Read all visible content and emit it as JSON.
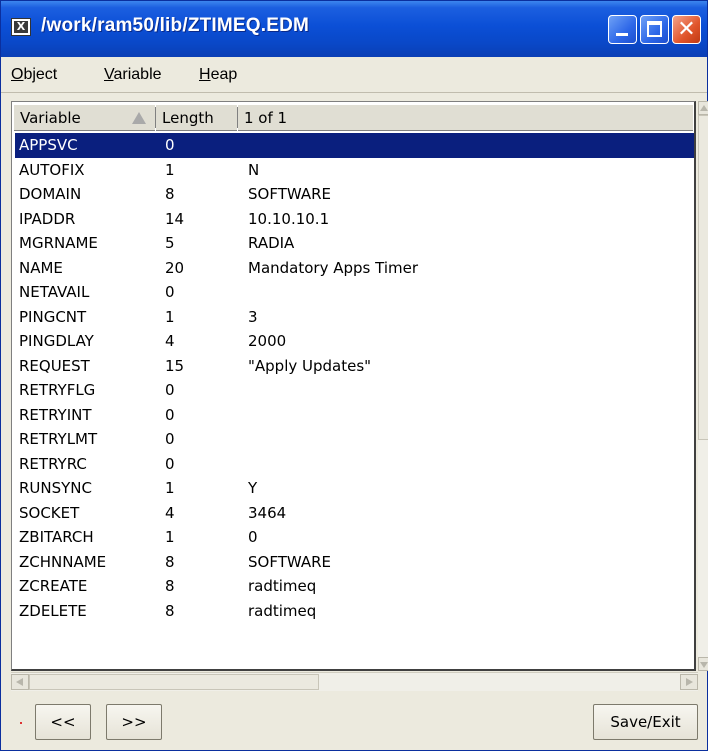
{
  "window": {
    "title": "/work/ram50/lib/ZTIMEQ.EDM",
    "app_icon_glyph": "X"
  },
  "menu": {
    "object": {
      "mnemonic": "O",
      "rest": "bject"
    },
    "variable": {
      "mnemonic": "V",
      "rest": "ariable"
    },
    "heap": {
      "mnemonic": "H",
      "rest": "eap"
    }
  },
  "table": {
    "headers": {
      "variable": "Variable",
      "length": "Length",
      "data": "1 of 1"
    },
    "rows": [
      {
        "variable": "APPSVC",
        "length": "0",
        "data": ""
      },
      {
        "variable": "AUTOFIX",
        "length": "1",
        "data": "N"
      },
      {
        "variable": "DOMAIN",
        "length": "8",
        "data": "SOFTWARE"
      },
      {
        "variable": "IPADDR",
        "length": "14",
        "data": "10.10.10.1"
      },
      {
        "variable": "MGRNAME",
        "length": "5",
        "data": "RADIA"
      },
      {
        "variable": "NAME",
        "length": "20",
        "data": "Mandatory Apps Timer"
      },
      {
        "variable": "NETAVAIL",
        "length": "0",
        "data": ""
      },
      {
        "variable": "PINGCNT",
        "length": "1",
        "data": "3"
      },
      {
        "variable": "PINGDLAY",
        "length": "4",
        "data": "2000"
      },
      {
        "variable": "REQUEST",
        "length": "15",
        "data": "\"Apply Updates\""
      },
      {
        "variable": "RETRYFLG",
        "length": "0",
        "data": ""
      },
      {
        "variable": "RETRYINT",
        "length": "0",
        "data": ""
      },
      {
        "variable": "RETRYLMT",
        "length": "0",
        "data": ""
      },
      {
        "variable": "RETRYRC",
        "length": "0",
        "data": ""
      },
      {
        "variable": "RUNSYNC",
        "length": "1",
        "data": "Y"
      },
      {
        "variable": "SOCKET",
        "length": "4",
        "data": "3464"
      },
      {
        "variable": "ZBITARCH",
        "length": "1",
        "data": "0"
      },
      {
        "variable": "ZCHNNAME",
        "length": "8",
        "data": "SOFTWARE"
      },
      {
        "variable": "ZCREATE",
        "length": "8",
        "data": "radtimeq"
      },
      {
        "variable": "ZDELETE",
        "length": "8",
        "data": "radtimeq"
      }
    ]
  },
  "buttons": {
    "prev": "<<",
    "next": ">>",
    "save_exit": "Save/Exit"
  },
  "colors": {
    "selection": "#0a1f7e",
    "titlebar": "#0b4fd6",
    "close_button": "#e0542a"
  }
}
